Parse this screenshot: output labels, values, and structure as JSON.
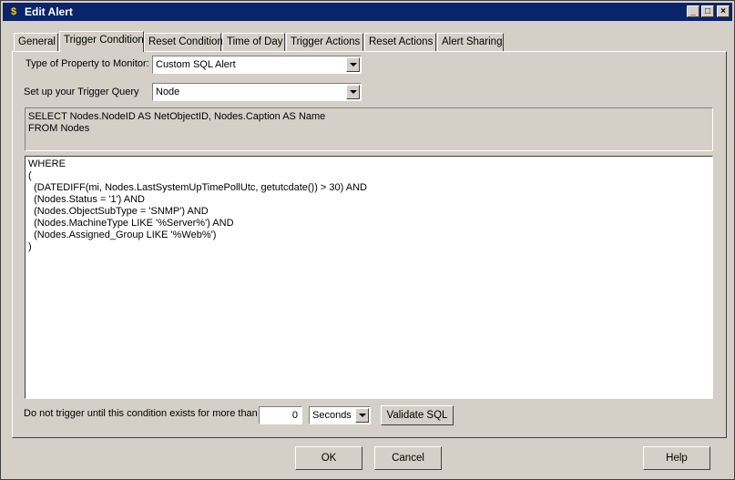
{
  "window": {
    "title": "Edit Alert"
  },
  "tabs": [
    "General",
    "Trigger Condition",
    "Reset Condition",
    "Time of Day",
    "Trigger Actions",
    "Reset Actions",
    "Alert Sharing"
  ],
  "form": {
    "property_label": "Type of Property to Monitor:",
    "property_value": "Custom SQL Alert",
    "query_label": "Set up your Trigger Query",
    "query_value": "Node",
    "sql_header": "SELECT Nodes.NodeID AS NetObjectID, Nodes.Caption AS Name\nFROM Nodes",
    "sql_body": "WHERE\n(\n  (DATEDIFF(mi, Nodes.LastSystemUpTimePollUtc, getutcdate()) > 30) AND\n  (Nodes.Status = '1') AND\n  (Nodes.ObjectSubType = 'SNMP') AND\n  (Nodes.MachineType LIKE '%Server%') AND\n  (Nodes.Assigned_Group LIKE '%Web%')\n)",
    "delay_label": "Do not trigger until this condition exists for more than",
    "delay_value": "0",
    "delay_unit": "Seconds",
    "validate_label": "Validate SQL"
  },
  "buttons": {
    "ok": "OK",
    "cancel": "Cancel",
    "help": "Help"
  }
}
